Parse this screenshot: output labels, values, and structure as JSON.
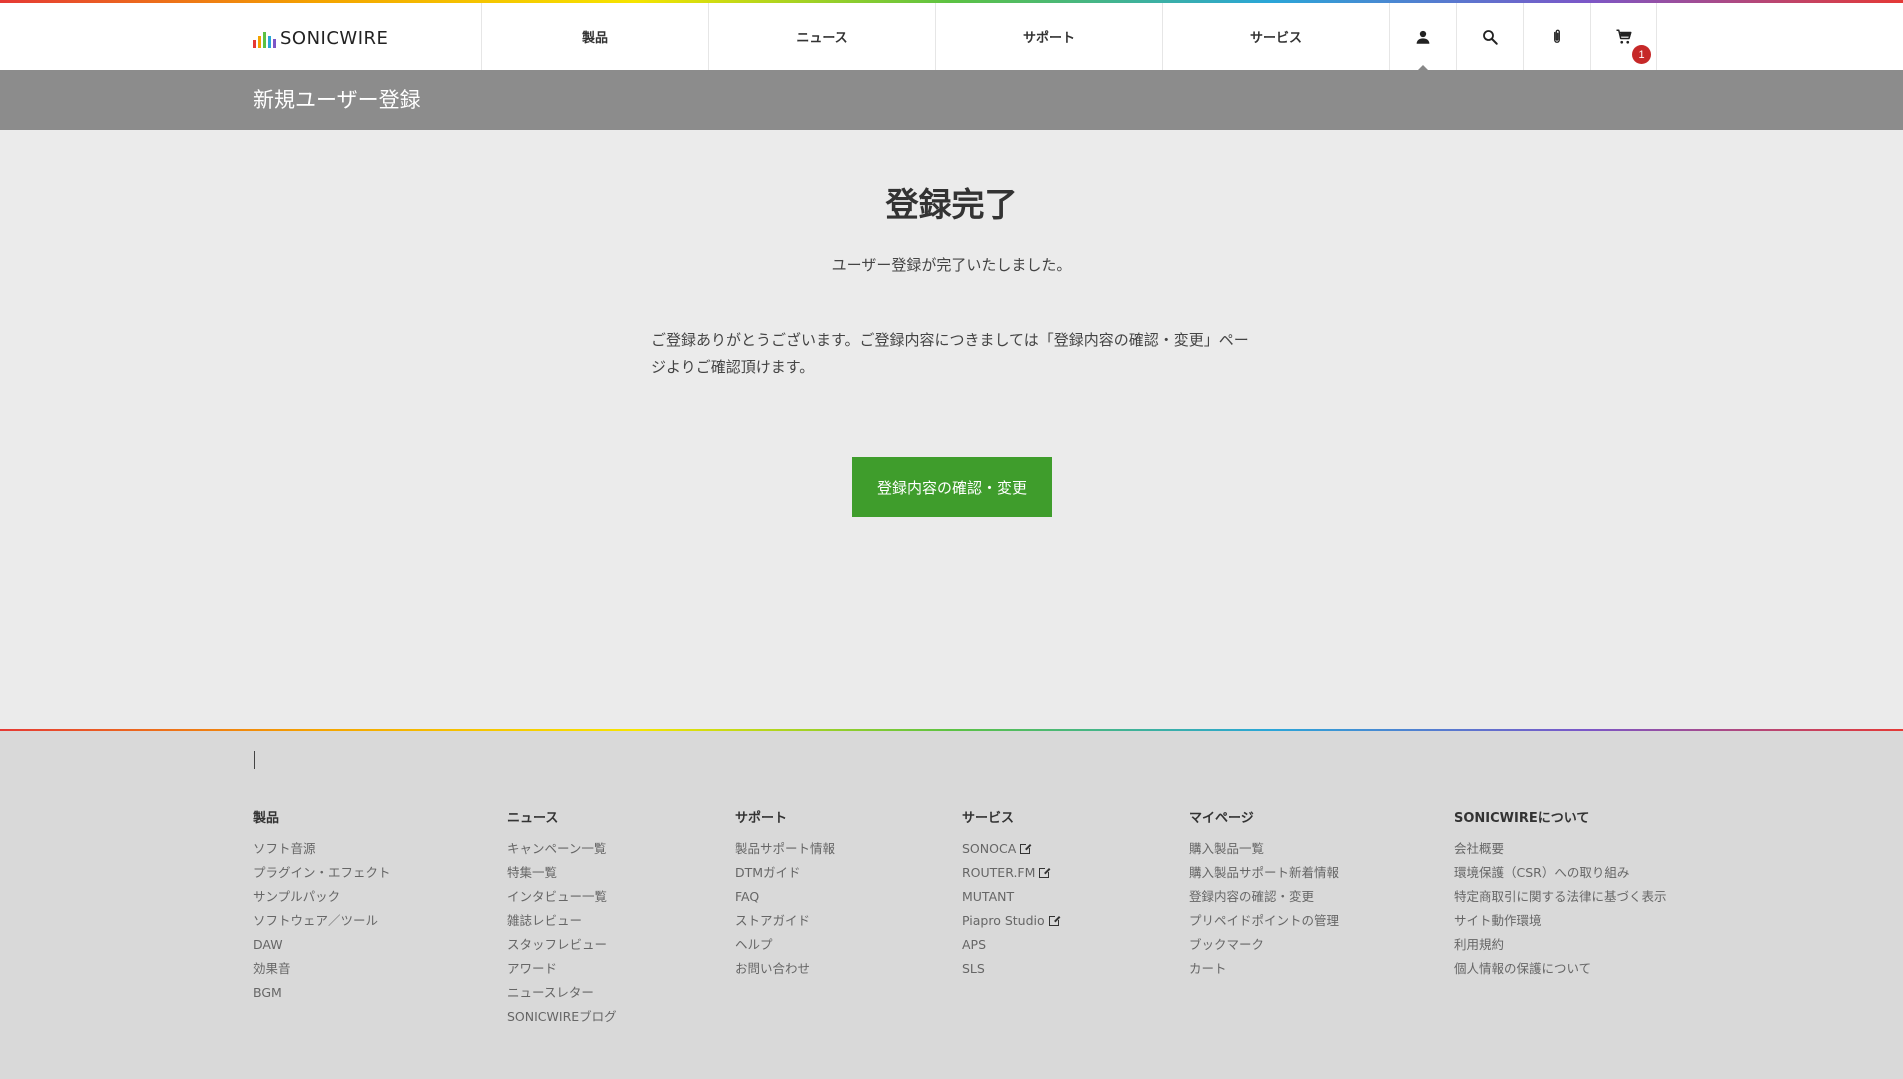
{
  "logo": {
    "text": "SONICWIRE",
    "bar_colors": [
      "#e53935",
      "#f4a300",
      "#5cc243",
      "#2aa6d8",
      "#7b57c8"
    ]
  },
  "nav": {
    "items": [
      {
        "label": "製品"
      },
      {
        "label": "ニュース"
      },
      {
        "label": "サポート"
      },
      {
        "label": "サービス"
      }
    ],
    "icons": [
      {
        "name": "user-icon",
        "active": true
      },
      {
        "name": "search-icon"
      },
      {
        "name": "paperclip-icon"
      },
      {
        "name": "cart-icon",
        "badge": "1"
      }
    ]
  },
  "page": {
    "title": "新規ユーザー登録"
  },
  "main": {
    "heading": "登録完了",
    "subheading": "ユーザー登録が完了いたしました。",
    "message": "ご登録ありがとうございます。ご登録内容につきましては「登録内容の確認・変更」ページよりご確認頂けます。",
    "button_label": "登録内容の確認・変更",
    "button_color": "#3f9d2c"
  },
  "footer": {
    "columns": [
      {
        "title": "製品",
        "items": [
          {
            "label": "ソフト音源"
          },
          {
            "label": "プラグイン・エフェクト"
          },
          {
            "label": "サンプルパック"
          },
          {
            "label": "ソフトウェア／ツール"
          },
          {
            "label": "DAW"
          },
          {
            "label": "効果音"
          },
          {
            "label": "BGM"
          }
        ]
      },
      {
        "title": "ニュース",
        "items": [
          {
            "label": "キャンペーン一覧"
          },
          {
            "label": "特集一覧"
          },
          {
            "label": "インタビュー一覧"
          },
          {
            "label": "雑誌レビュー"
          },
          {
            "label": "スタッフレビュー"
          },
          {
            "label": "アワード"
          },
          {
            "label": "ニュースレター"
          },
          {
            "label": "SONICWIREブログ"
          }
        ]
      },
      {
        "title": "サポート",
        "items": [
          {
            "label": "製品サポート情報"
          },
          {
            "label": "DTMガイド"
          },
          {
            "label": "FAQ"
          },
          {
            "label": "ストアガイド"
          },
          {
            "label": "ヘルプ"
          },
          {
            "label": "お問い合わせ"
          }
        ]
      },
      {
        "title": "サービス",
        "items": [
          {
            "label": "SONOCA",
            "external": true
          },
          {
            "label": "ROUTER.FM",
            "external": true
          },
          {
            "label": "MUTANT"
          },
          {
            "label": "Piapro Studio",
            "external": true
          },
          {
            "label": "APS"
          },
          {
            "label": "SLS"
          }
        ]
      },
      {
        "title": "マイページ",
        "items": [
          {
            "label": "購入製品一覧"
          },
          {
            "label": "購入製品サポート新着情報"
          },
          {
            "label": "登録内容の確認・変更"
          },
          {
            "label": "プリペイドポイントの管理"
          },
          {
            "label": "ブックマーク"
          },
          {
            "label": "カート"
          }
        ]
      },
      {
        "title": "SONICWIREについて",
        "items": [
          {
            "label": "会社概要"
          },
          {
            "label": "環境保護（CSR）への取り組み"
          },
          {
            "label": "特定商取引に関する法律に基づく表示"
          },
          {
            "label": "サイト動作環境"
          },
          {
            "label": "利用規約"
          },
          {
            "label": "個人情報の保護について"
          }
        ]
      }
    ]
  }
}
